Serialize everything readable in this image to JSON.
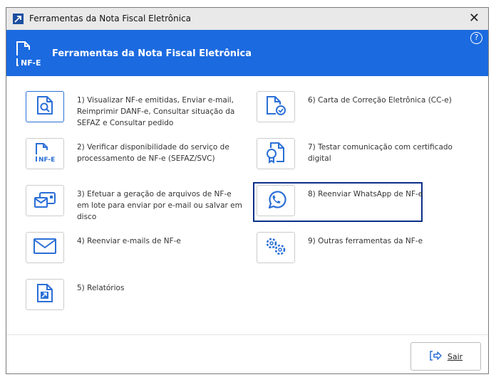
{
  "window": {
    "title": "Ferramentas da Nota Fiscal Eletrônica"
  },
  "header": {
    "title": "Ferramentas da Nota Fiscal Eletrônica",
    "logo_text": "NF-E",
    "help": "?"
  },
  "left_items": [
    {
      "label": "1) Visualizar NF-e emitidas, Enviar e-mail, Reimprimir DANF-e, Consultar situação da SEFAZ e Consultar pedido",
      "icon": "document-search-icon"
    },
    {
      "label": "2) Verificar disponibilidade do serviço de processamento de NF-e (SEFAZ/SVC)",
      "icon": "nfe-document-icon"
    },
    {
      "label": "3) Efetuar a geração de arquivos de NF-e em lote para enviar por e-mail ou salvar em disco",
      "icon": "batch-mail-icon"
    },
    {
      "label": "4) Reenviar e-mails de NF-e",
      "icon": "envelope-icon"
    },
    {
      "label": "5) Relatórios",
      "icon": "report-icon"
    }
  ],
  "right_items": [
    {
      "label": "6) Carta de Correção Eletrônica (CC-e)",
      "icon": "document-check-icon"
    },
    {
      "label": "7) Testar comunicação com certificado digital",
      "icon": "certificate-icon"
    },
    {
      "label": "8) Reenviar WhatsApp de NF-e",
      "icon": "whatsapp-icon"
    },
    {
      "label": "9) Outras ferramentas da NF-e",
      "icon": "gears-icon"
    }
  ],
  "footer": {
    "exit_label": "Sair"
  },
  "colors": {
    "accent": "#1b6ae0",
    "highlight": "#0b2e8a"
  }
}
